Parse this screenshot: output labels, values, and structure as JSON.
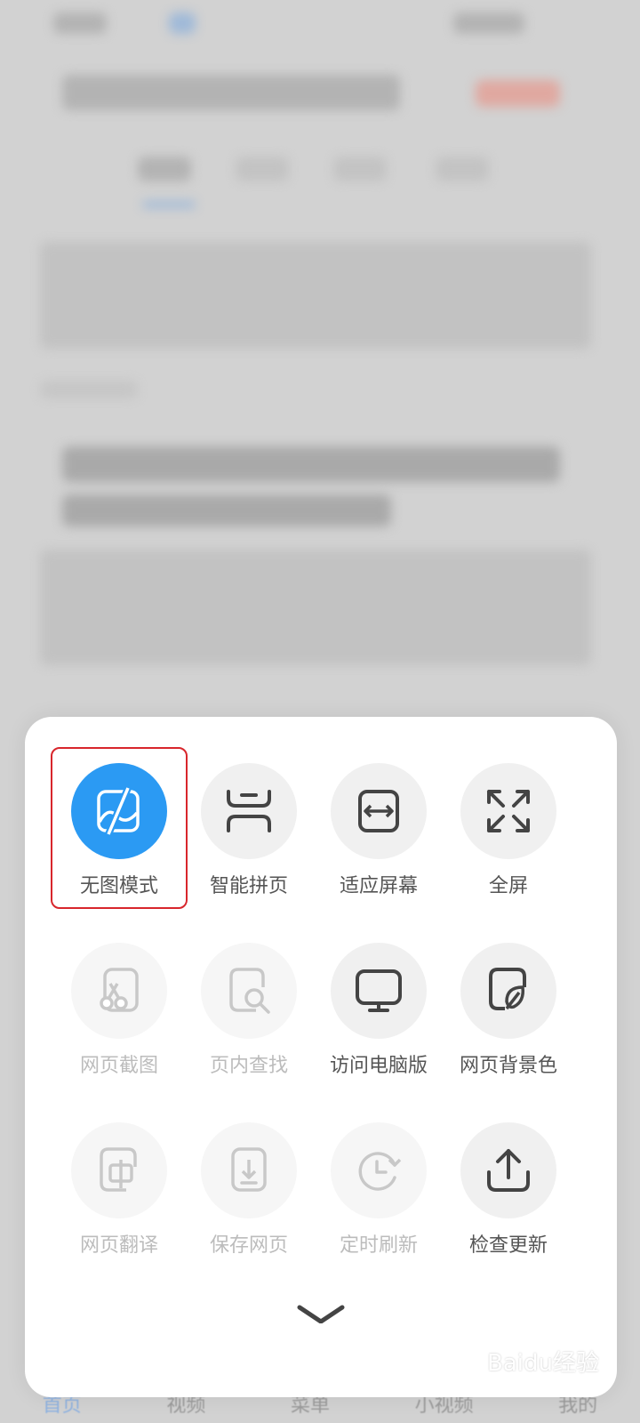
{
  "bottom_nav": {
    "items": [
      "首页",
      "视频",
      "菜单",
      "小视频",
      "我的"
    ]
  },
  "menu": {
    "rows": [
      [
        {
          "label": "无图模式",
          "icon": "no-image-icon",
          "state": "active"
        },
        {
          "label": "智能拼页",
          "icon": "page-stitch-icon",
          "state": "enabled"
        },
        {
          "label": "适应屏幕",
          "icon": "fit-screen-icon",
          "state": "enabled"
        },
        {
          "label": "全屏",
          "icon": "fullscreen-icon",
          "state": "enabled"
        }
      ],
      [
        {
          "label": "网页截图",
          "icon": "screenshot-icon",
          "state": "disabled"
        },
        {
          "label": "页内查找",
          "icon": "find-in-page-icon",
          "state": "disabled"
        },
        {
          "label": "访问电脑版",
          "icon": "desktop-version-icon",
          "state": "enabled"
        },
        {
          "label": "网页背景色",
          "icon": "background-color-icon",
          "state": "enabled"
        }
      ],
      [
        {
          "label": "网页翻译",
          "icon": "translate-icon",
          "state": "disabled"
        },
        {
          "label": "保存网页",
          "icon": "save-page-icon",
          "state": "disabled"
        },
        {
          "label": "定时刷新",
          "icon": "timed-refresh-icon",
          "state": "disabled"
        },
        {
          "label": "检查更新",
          "icon": "check-update-icon",
          "state": "enabled"
        }
      ]
    ]
  },
  "colors": {
    "accent": "#2b9af3",
    "highlight_border": "#d8262c"
  },
  "watermark": "Baidu经验"
}
